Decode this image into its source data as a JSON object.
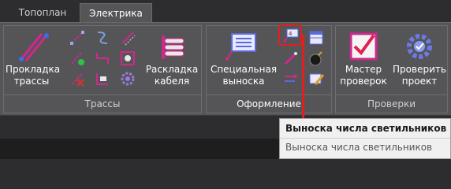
{
  "tabs": [
    {
      "label": "Топоплан",
      "active": false
    },
    {
      "label": "Электрика",
      "active": true
    }
  ],
  "groups": {
    "routes": {
      "title": "Трассы",
      "buttons": {
        "route_laying": "Прокладка\nтрассы",
        "cable_layout": "Раскладка\nкабеля"
      }
    },
    "design": {
      "title": "Оформление",
      "buttons": {
        "special_callout": "Специальная\nвыноска"
      }
    },
    "checks": {
      "title": "Проверки",
      "buttons": {
        "check_master": "Мастер\nпроверок",
        "check_project": "Проверить\nпроект"
      }
    }
  },
  "tooltip": {
    "title": "Выноска числа светильников",
    "description": "Выноска числа светильников"
  },
  "colors": {
    "ribbon_bg": "#555558",
    "tab_bar_bg": "#2d2d30",
    "accent_pink": "#d0288c",
    "highlight_red": "#e02020",
    "tooltip_bg": "#f0f0f0"
  }
}
